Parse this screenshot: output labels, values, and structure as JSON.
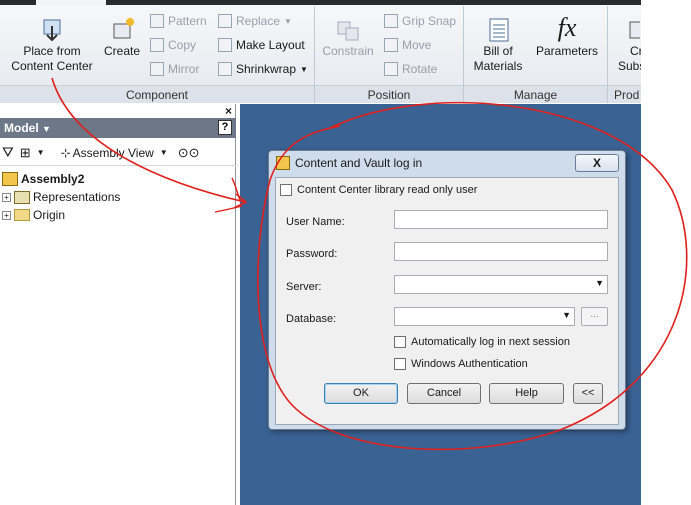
{
  "ribbon": {
    "place_from_content_center": "Place from Content Center",
    "create": "Create",
    "pattern": "Pattern",
    "copy": "Copy",
    "mirror": "Mirror",
    "replace": "Replace",
    "make_layout": "Make Layout",
    "shrinkwrap": "Shrinkwrap",
    "constrain": "Constrain",
    "grip_snap": "Grip Snap",
    "move": "Move",
    "rotate": "Rotate",
    "bill_of_materials": "Bill of Materials",
    "parameters": "Parameters",
    "parameters_symbol": "fx",
    "cr_subs_line1": "Cr",
    "cr_subs_line2": "Subs",
    "panels": {
      "component": "Component",
      "position": "Position",
      "manage": "Manage",
      "prod": "Prod"
    }
  },
  "browser": {
    "title": "Model",
    "help": "?",
    "close": "×",
    "view": "Assembly View",
    "tree": [
      {
        "label": "Assembly2",
        "bold": true
      },
      {
        "label": "Representations"
      },
      {
        "label": "Origin"
      }
    ]
  },
  "dialog": {
    "title": "Content and Vault log in",
    "close": "X",
    "readonly_label": "Content Center library read only user",
    "username_label": "User Name:",
    "username_value": "",
    "password_label": "Password:",
    "password_value": "",
    "server_label": "Server:",
    "server_value": "",
    "database_label": "Database:",
    "database_value": "",
    "browse": "...",
    "auto_login_label": "Automatically log in next session",
    "windows_auth_label": "Windows Authentication",
    "ok": "OK",
    "cancel": "Cancel",
    "help": "Help",
    "more": "<<"
  },
  "colors": {
    "canvas": "#3a6394",
    "annotation": "#e0201b"
  }
}
